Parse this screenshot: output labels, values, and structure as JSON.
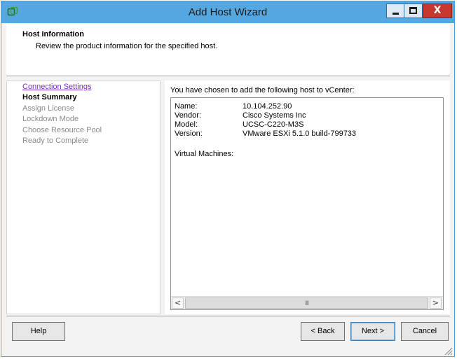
{
  "window": {
    "title": "Add Host Wizard",
    "min_icon": "minimize-icon",
    "max_icon": "maximize-icon",
    "close_icon": "close-icon",
    "close_glyph": "X",
    "app_icon": "vcenter-app-icon"
  },
  "header": {
    "title": "Host Information",
    "subtitle": "Review the product information for the specified host."
  },
  "steps": [
    {
      "label": "Connection Settings",
      "state": "link"
    },
    {
      "label": "Host Summary",
      "state": "current"
    },
    {
      "label": "Assign License",
      "state": "disabled"
    },
    {
      "label": "Lockdown Mode",
      "state": "disabled"
    },
    {
      "label": "Choose Resource Pool",
      "state": "disabled"
    },
    {
      "label": "Ready to Complete",
      "state": "disabled"
    }
  ],
  "summary": {
    "intro": "You have chosen to add the following host to vCenter:",
    "fields": [
      {
        "label": "Name:",
        "value": "10.104.252.90"
      },
      {
        "label": "Vendor:",
        "value": "Cisco Systems Inc"
      },
      {
        "label": "Model:",
        "value": "UCSC-C220-M3S"
      },
      {
        "label": "Version:",
        "value": "VMware ESXi 5.1.0 build-799733"
      }
    ],
    "vm_label": "Virtual Machines:"
  },
  "scrollbar": {
    "left_glyph": "<",
    "right_glyph": ">",
    "grip_glyph": "III"
  },
  "buttons": {
    "help": "Help",
    "back": "< Back",
    "next": "Next >",
    "cancel": "Cancel"
  },
  "colors": {
    "titlebar": "#54a7e0",
    "close_button": "#c7392f",
    "visited_link": "#7b2fbf",
    "disabled_text": "#8a8a8a"
  }
}
